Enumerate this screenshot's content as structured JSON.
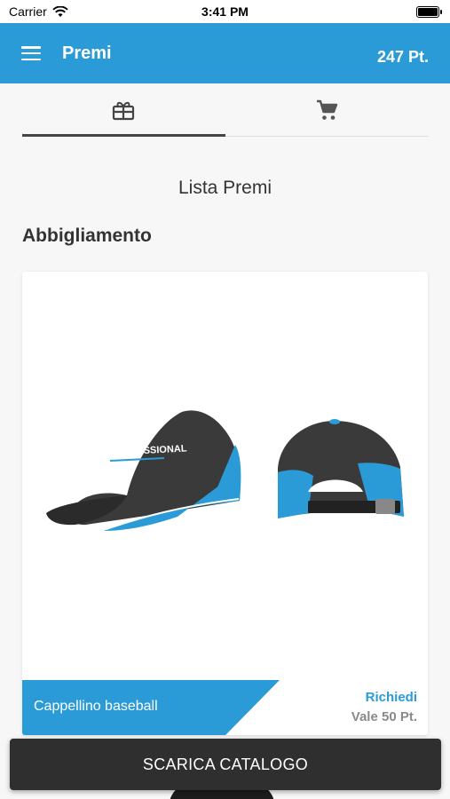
{
  "status_bar": {
    "carrier": "Carrier",
    "time": "3:41 PM"
  },
  "app_bar": {
    "title": "Premi",
    "points": "247 Pt."
  },
  "tabs": [
    {
      "icon": "gift-icon",
      "active": true
    },
    {
      "icon": "cart-icon",
      "active": false
    }
  ],
  "main": {
    "section_heading": "Lista Premi",
    "category": "Abbigliamento"
  },
  "products": [
    {
      "name": "Cappellino baseball",
      "request_label": "Richiedi",
      "value": "Vale 50 Pt.",
      "image_text": "PROFESSIONAL"
    }
  ],
  "bottom_button": {
    "label": "SCARICA CATALOGO"
  },
  "colors": {
    "primary": "#2a9bd6",
    "dark": "#2f2f2f",
    "cap_dark": "#3a3a3a",
    "cap_blue": "#2a9bd6"
  }
}
